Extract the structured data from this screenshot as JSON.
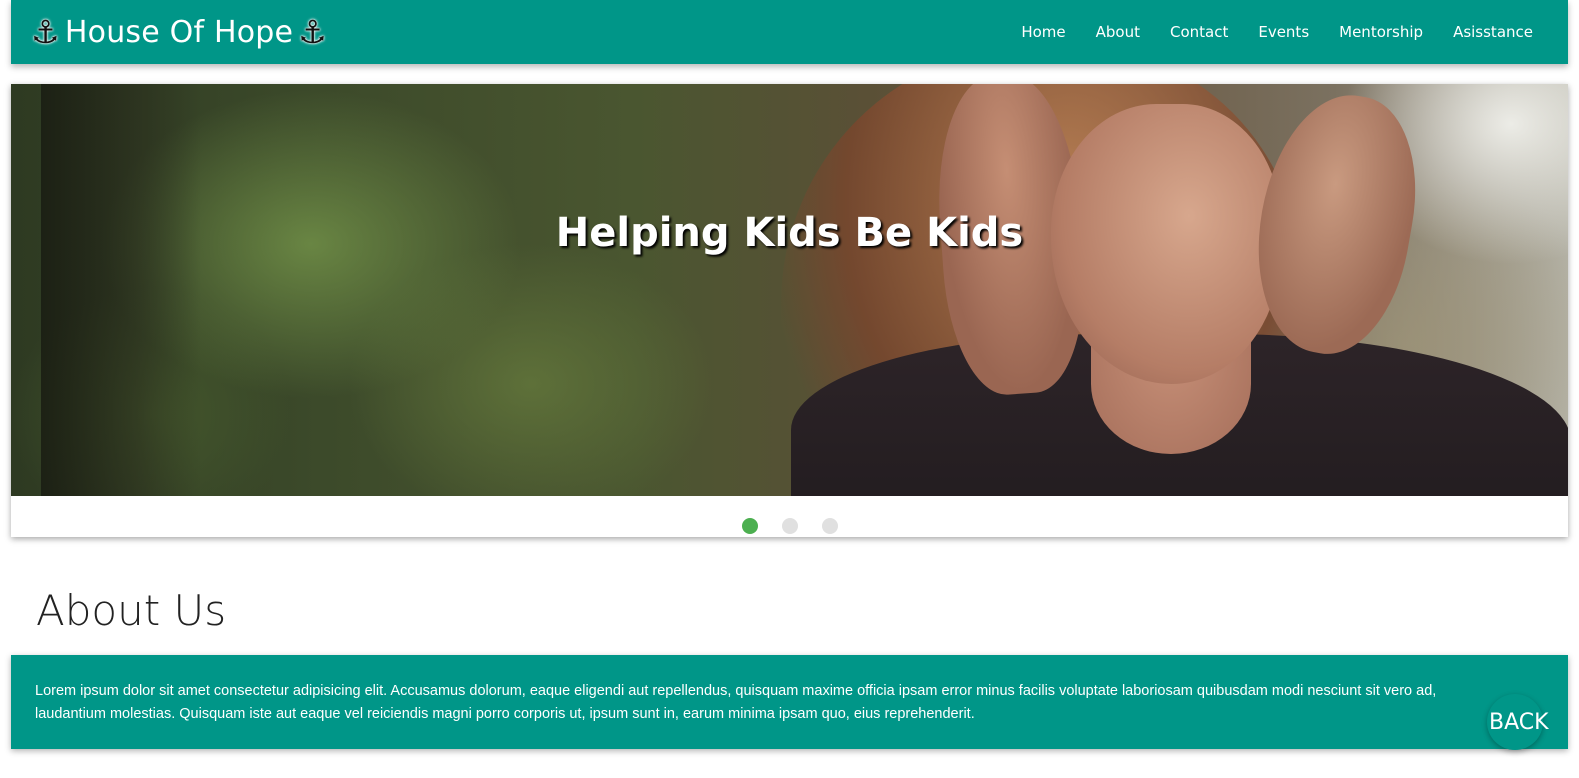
{
  "navbar": {
    "brand_icon_left": "⚓",
    "brand_title": "House Of Hope",
    "brand_icon_right": "⚓",
    "links": [
      "Home",
      "About",
      "Contact",
      "Events",
      "Mentorship",
      "Asisstance"
    ]
  },
  "slider": {
    "caption": "Helping Kids Be Kids",
    "slide_count": 3,
    "active_index": 0
  },
  "about": {
    "heading": "About Us",
    "body": "Lorem ipsum dolor sit amet consectetur adipisicing elit. Accusamus dolorum, eaque eligendi aut repellendus, quisquam maxime officia ipsam error minus facilis voluptate laboriosam quibusdam modi nesciunt sit vero ad, laudantium molestias. Quisquam iste aut eaque vel reiciendis magni porro corporis ut, ipsum sunt in, earum minima ipsam quo, eius reprehenderit."
  },
  "back_button": {
    "label": "BACK"
  },
  "colors": {
    "primary": "#009688",
    "indicator_active": "#4caf50",
    "indicator_inactive": "#e0e0e0"
  },
  "icons": {
    "brand": "anchor-icon"
  }
}
